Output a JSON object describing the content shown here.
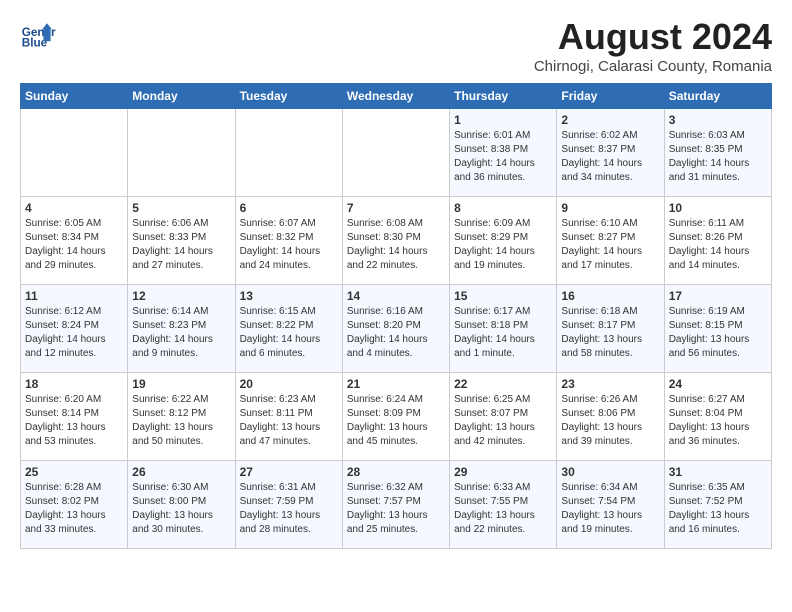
{
  "header": {
    "logo_line1": "General",
    "logo_line2": "Blue",
    "title": "August 2024",
    "subtitle": "Chirnogi, Calarasi County, Romania"
  },
  "weekdays": [
    "Sunday",
    "Monday",
    "Tuesday",
    "Wednesday",
    "Thursday",
    "Friday",
    "Saturday"
  ],
  "weeks": [
    [
      {
        "day": "",
        "info": ""
      },
      {
        "day": "",
        "info": ""
      },
      {
        "day": "",
        "info": ""
      },
      {
        "day": "",
        "info": ""
      },
      {
        "day": "1",
        "info": "Sunrise: 6:01 AM\nSunset: 8:38 PM\nDaylight: 14 hours\nand 36 minutes."
      },
      {
        "day": "2",
        "info": "Sunrise: 6:02 AM\nSunset: 8:37 PM\nDaylight: 14 hours\nand 34 minutes."
      },
      {
        "day": "3",
        "info": "Sunrise: 6:03 AM\nSunset: 8:35 PM\nDaylight: 14 hours\nand 31 minutes."
      }
    ],
    [
      {
        "day": "4",
        "info": "Sunrise: 6:05 AM\nSunset: 8:34 PM\nDaylight: 14 hours\nand 29 minutes."
      },
      {
        "day": "5",
        "info": "Sunrise: 6:06 AM\nSunset: 8:33 PM\nDaylight: 14 hours\nand 27 minutes."
      },
      {
        "day": "6",
        "info": "Sunrise: 6:07 AM\nSunset: 8:32 PM\nDaylight: 14 hours\nand 24 minutes."
      },
      {
        "day": "7",
        "info": "Sunrise: 6:08 AM\nSunset: 8:30 PM\nDaylight: 14 hours\nand 22 minutes."
      },
      {
        "day": "8",
        "info": "Sunrise: 6:09 AM\nSunset: 8:29 PM\nDaylight: 14 hours\nand 19 minutes."
      },
      {
        "day": "9",
        "info": "Sunrise: 6:10 AM\nSunset: 8:27 PM\nDaylight: 14 hours\nand 17 minutes."
      },
      {
        "day": "10",
        "info": "Sunrise: 6:11 AM\nSunset: 8:26 PM\nDaylight: 14 hours\nand 14 minutes."
      }
    ],
    [
      {
        "day": "11",
        "info": "Sunrise: 6:12 AM\nSunset: 8:24 PM\nDaylight: 14 hours\nand 12 minutes."
      },
      {
        "day": "12",
        "info": "Sunrise: 6:14 AM\nSunset: 8:23 PM\nDaylight: 14 hours\nand 9 minutes."
      },
      {
        "day": "13",
        "info": "Sunrise: 6:15 AM\nSunset: 8:22 PM\nDaylight: 14 hours\nand 6 minutes."
      },
      {
        "day": "14",
        "info": "Sunrise: 6:16 AM\nSunset: 8:20 PM\nDaylight: 14 hours\nand 4 minutes."
      },
      {
        "day": "15",
        "info": "Sunrise: 6:17 AM\nSunset: 8:18 PM\nDaylight: 14 hours\nand 1 minute."
      },
      {
        "day": "16",
        "info": "Sunrise: 6:18 AM\nSunset: 8:17 PM\nDaylight: 13 hours\nand 58 minutes."
      },
      {
        "day": "17",
        "info": "Sunrise: 6:19 AM\nSunset: 8:15 PM\nDaylight: 13 hours\nand 56 minutes."
      }
    ],
    [
      {
        "day": "18",
        "info": "Sunrise: 6:20 AM\nSunset: 8:14 PM\nDaylight: 13 hours\nand 53 minutes."
      },
      {
        "day": "19",
        "info": "Sunrise: 6:22 AM\nSunset: 8:12 PM\nDaylight: 13 hours\nand 50 minutes."
      },
      {
        "day": "20",
        "info": "Sunrise: 6:23 AM\nSunset: 8:11 PM\nDaylight: 13 hours\nand 47 minutes."
      },
      {
        "day": "21",
        "info": "Sunrise: 6:24 AM\nSunset: 8:09 PM\nDaylight: 13 hours\nand 45 minutes."
      },
      {
        "day": "22",
        "info": "Sunrise: 6:25 AM\nSunset: 8:07 PM\nDaylight: 13 hours\nand 42 minutes."
      },
      {
        "day": "23",
        "info": "Sunrise: 6:26 AM\nSunset: 8:06 PM\nDaylight: 13 hours\nand 39 minutes."
      },
      {
        "day": "24",
        "info": "Sunrise: 6:27 AM\nSunset: 8:04 PM\nDaylight: 13 hours\nand 36 minutes."
      }
    ],
    [
      {
        "day": "25",
        "info": "Sunrise: 6:28 AM\nSunset: 8:02 PM\nDaylight: 13 hours\nand 33 minutes."
      },
      {
        "day": "26",
        "info": "Sunrise: 6:30 AM\nSunset: 8:00 PM\nDaylight: 13 hours\nand 30 minutes."
      },
      {
        "day": "27",
        "info": "Sunrise: 6:31 AM\nSunset: 7:59 PM\nDaylight: 13 hours\nand 28 minutes."
      },
      {
        "day": "28",
        "info": "Sunrise: 6:32 AM\nSunset: 7:57 PM\nDaylight: 13 hours\nand 25 minutes."
      },
      {
        "day": "29",
        "info": "Sunrise: 6:33 AM\nSunset: 7:55 PM\nDaylight: 13 hours\nand 22 minutes."
      },
      {
        "day": "30",
        "info": "Sunrise: 6:34 AM\nSunset: 7:54 PM\nDaylight: 13 hours\nand 19 minutes."
      },
      {
        "day": "31",
        "info": "Sunrise: 6:35 AM\nSunset: 7:52 PM\nDaylight: 13 hours\nand 16 minutes."
      }
    ]
  ]
}
